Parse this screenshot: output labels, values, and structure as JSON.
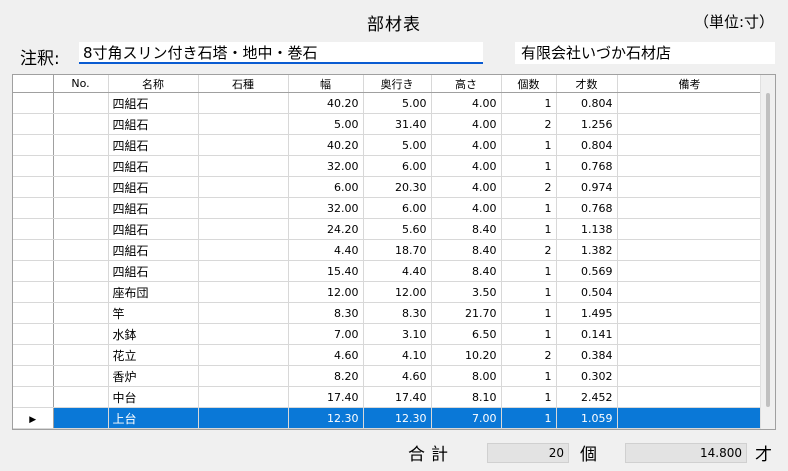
{
  "title": "部材表",
  "unit": "（単位:寸）",
  "note_label": "注釈:",
  "note_value": "8寸角スリン付き石塔・地中・巻石",
  "company": "有限会社いづか石材店",
  "columns": [
    "No.",
    "名称",
    "石種",
    "幅",
    "奥行き",
    "高さ",
    "個数",
    "才数",
    "備考"
  ],
  "rows": [
    {
      "no": "",
      "name": "四組石",
      "stone": "",
      "w": "40.20",
      "d": "5.00",
      "h": "4.00",
      "qty": "1",
      "sai": "0.804",
      "note": ""
    },
    {
      "no": "",
      "name": "四組石",
      "stone": "",
      "w": "5.00",
      "d": "31.40",
      "h": "4.00",
      "qty": "2",
      "sai": "1.256",
      "note": ""
    },
    {
      "no": "",
      "name": "四組石",
      "stone": "",
      "w": "40.20",
      "d": "5.00",
      "h": "4.00",
      "qty": "1",
      "sai": "0.804",
      "note": ""
    },
    {
      "no": "",
      "name": "四組石",
      "stone": "",
      "w": "32.00",
      "d": "6.00",
      "h": "4.00",
      "qty": "1",
      "sai": "0.768",
      "note": ""
    },
    {
      "no": "",
      "name": "四組石",
      "stone": "",
      "w": "6.00",
      "d": "20.30",
      "h": "4.00",
      "qty": "2",
      "sai": "0.974",
      "note": ""
    },
    {
      "no": "",
      "name": "四組石",
      "stone": "",
      "w": "32.00",
      "d": "6.00",
      "h": "4.00",
      "qty": "1",
      "sai": "0.768",
      "note": ""
    },
    {
      "no": "",
      "name": "四組石",
      "stone": "",
      "w": "24.20",
      "d": "5.60",
      "h": "8.40",
      "qty": "1",
      "sai": "1.138",
      "note": ""
    },
    {
      "no": "",
      "name": "四組石",
      "stone": "",
      "w": "4.40",
      "d": "18.70",
      "h": "8.40",
      "qty": "2",
      "sai": "1.382",
      "note": ""
    },
    {
      "no": "",
      "name": "四組石",
      "stone": "",
      "w": "15.40",
      "d": "4.40",
      "h": "8.40",
      "qty": "1",
      "sai": "0.569",
      "note": ""
    },
    {
      "no": "",
      "name": "座布団",
      "stone": "",
      "w": "12.00",
      "d": "12.00",
      "h": "3.50",
      "qty": "1",
      "sai": "0.504",
      "note": ""
    },
    {
      "no": "",
      "name": "竿",
      "stone": "",
      "w": "8.30",
      "d": "8.30",
      "h": "21.70",
      "qty": "1",
      "sai": "1.495",
      "note": ""
    },
    {
      "no": "",
      "name": "水鉢",
      "stone": "",
      "w": "7.00",
      "d": "3.10",
      "h": "6.50",
      "qty": "1",
      "sai": "0.141",
      "note": ""
    },
    {
      "no": "",
      "name": "花立",
      "stone": "",
      "w": "4.60",
      "d": "4.10",
      "h": "10.20",
      "qty": "2",
      "sai": "0.384",
      "note": ""
    },
    {
      "no": "",
      "name": "香炉",
      "stone": "",
      "w": "8.20",
      "d": "4.60",
      "h": "8.00",
      "qty": "1",
      "sai": "0.302",
      "note": ""
    },
    {
      "no": "",
      "name": "中台",
      "stone": "",
      "w": "17.40",
      "d": "17.40",
      "h": "8.10",
      "qty": "1",
      "sai": "2.452",
      "note": ""
    },
    {
      "no": "",
      "name": "上台",
      "stone": "",
      "w": "12.30",
      "d": "12.30",
      "h": "7.00",
      "qty": "1",
      "sai": "1.059",
      "note": ""
    }
  ],
  "selected_row": 15,
  "row_indicator": "▶",
  "total_label": "合計",
  "total_count": "20",
  "count_unit": "個",
  "total_volume": "14.800",
  "volume_unit": "才",
  "colors": {
    "selection": "#0a78d7",
    "note_underline": "#0a5bd1"
  }
}
